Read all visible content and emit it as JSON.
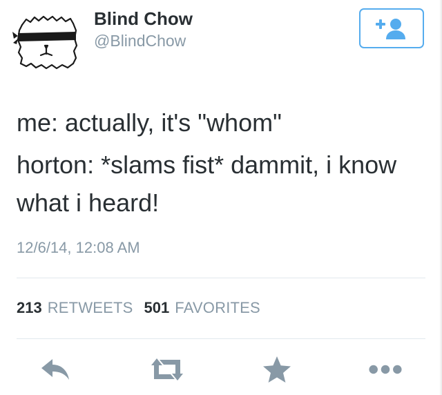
{
  "user": {
    "display_name": "Blind Chow",
    "handle": "@BlindChow"
  },
  "follow_button": {
    "icon": "add-user-icon",
    "plus_glyph": "+"
  },
  "tweet": {
    "lines": [
      "me: actually, it's \"whom\"",
      "horton: *slams fist* dammit, i know what i heard!"
    ],
    "timestamp": "12/6/14, 12:08 AM"
  },
  "stats": {
    "retweets_count": "213",
    "retweets_label": "RETWEETS",
    "favorites_count": "501",
    "favorites_label": "FAVORITES"
  },
  "actions": {
    "reply_icon": "reply-icon",
    "retweet_icon": "retweet-icon",
    "favorite_icon": "star-icon",
    "more_icon": "more-dots-icon"
  },
  "colors": {
    "accent": "#55acee",
    "text": "#292f33",
    "muted": "#8899a6",
    "icon": "#8899a6",
    "divider": "#e1e8ed"
  }
}
